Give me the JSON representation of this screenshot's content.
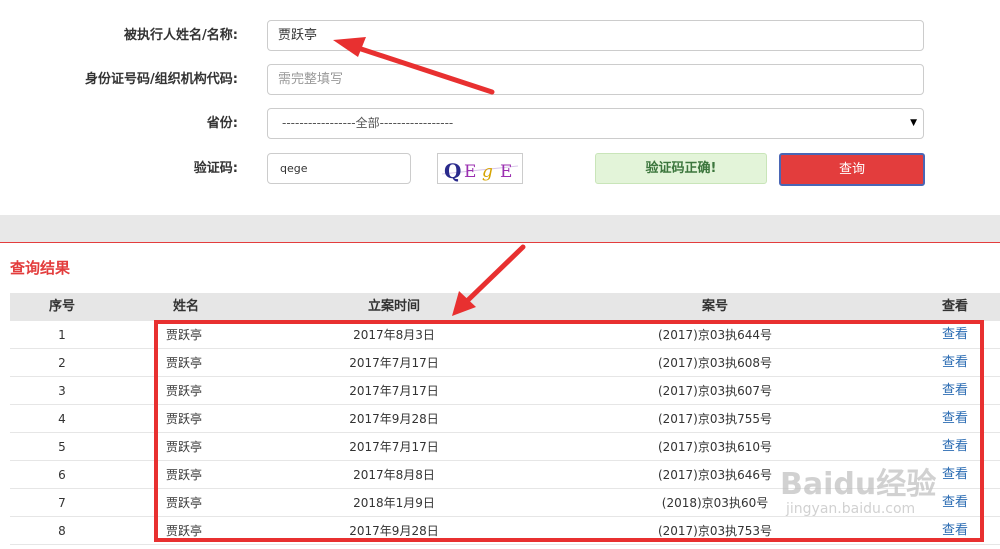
{
  "form": {
    "name_label": "被执行人姓名/名称:",
    "name_value": "贾跃亭",
    "id_label": "身份证号码/组织机构代码:",
    "id_placeholder": "需完整填写",
    "province_label": "省份:",
    "province_value": "-----------------全部-----------------",
    "captcha_label": "验证码:",
    "captcha_value": "qege",
    "captcha_image_text": "QEgE",
    "captcha_status": "验证码正确!",
    "query_button": "查询"
  },
  "results": {
    "title": "查询结果",
    "columns": [
      "序号",
      "姓名",
      "立案时间",
      "案号",
      "查看"
    ],
    "rows": [
      {
        "idx": "1",
        "name": "贾跃亭",
        "date": "2017年8月3日",
        "case": "(2017)京03执644号",
        "view": "查看"
      },
      {
        "idx": "2",
        "name": "贾跃亭",
        "date": "2017年7月17日",
        "case": "(2017)京03执608号",
        "view": "查看"
      },
      {
        "idx": "3",
        "name": "贾跃亭",
        "date": "2017年7月17日",
        "case": "(2017)京03执607号",
        "view": "查看"
      },
      {
        "idx": "4",
        "name": "贾跃亭",
        "date": "2017年9月28日",
        "case": "(2017)京03执755号",
        "view": "查看"
      },
      {
        "idx": "5",
        "name": "贾跃亭",
        "date": "2017年7月17日",
        "case": "(2017)京03执610号",
        "view": "查看"
      },
      {
        "idx": "6",
        "name": "贾跃亭",
        "date": "2017年8月8日",
        "case": "(2017)京03执646号",
        "view": "查看"
      },
      {
        "idx": "7",
        "name": "贾跃亭",
        "date": "2018年1月9日",
        "case": "(2018)京03执60号",
        "view": "查看"
      },
      {
        "idx": "8",
        "name": "贾跃亭",
        "date": "2017年9月28日",
        "case": "(2017)京03执753号",
        "view": "查看"
      }
    ]
  },
  "watermark": {
    "brand": "Baidu经验",
    "url": "jingyan.baidu.com"
  },
  "colors": {
    "accent_red": "#e33d3d",
    "annotation_red": "#e83030",
    "link_blue": "#2b6cb3",
    "success_green": "#e3f4d9"
  }
}
